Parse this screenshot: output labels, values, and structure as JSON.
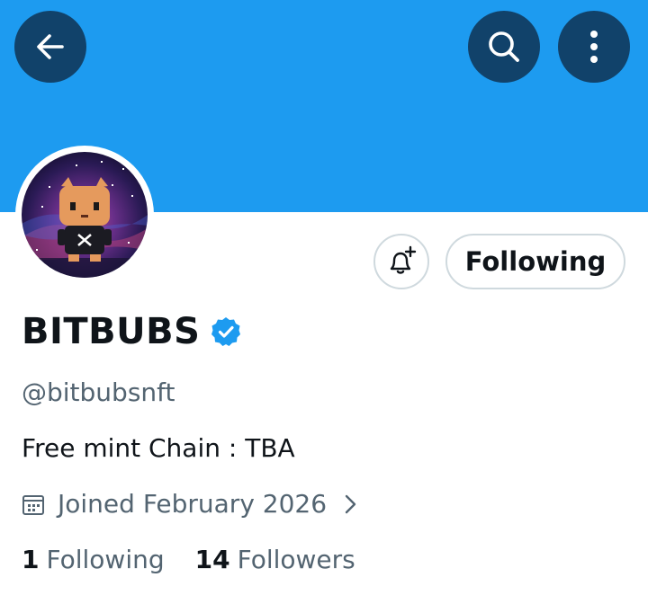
{
  "colors": {
    "banner": "#1d9bf0",
    "icon_button_bg": "#11426a",
    "verified_badge": "#1d9bf0",
    "text_primary": "#0f1419",
    "text_secondary": "#536471",
    "button_border": "#cfd9de"
  },
  "header": {
    "back_icon": "arrow-left-icon",
    "search_icon": "search-icon",
    "more_icon": "more-vertical-icon"
  },
  "profile": {
    "display_name": "BITBUBS",
    "verified_icon": "verified-badge-icon",
    "handle": "@bitbubsnft",
    "bio": "Free mint Chain : TBA",
    "joined": "Joined February 2026",
    "stats": {
      "following_count": "1",
      "following_label": "Following",
      "followers_count": "14",
      "followers_label": "Followers"
    }
  },
  "actions": {
    "notify_icon": "bell-plus-icon",
    "follow_button_label": "Following"
  }
}
